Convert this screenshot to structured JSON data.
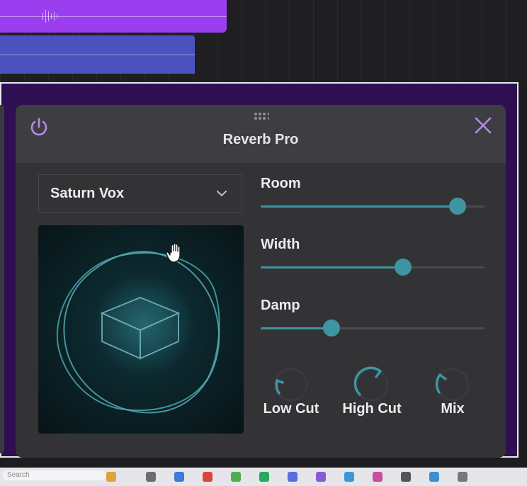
{
  "plugin": {
    "title": "Reverb Pro",
    "preset": "Saturn Vox"
  },
  "sliders": [
    {
      "label": "Room",
      "value": 0.88
    },
    {
      "label": "Width",
      "value": 0.635
    },
    {
      "label": "Damp",
      "value": 0.315
    }
  ],
  "knobs": [
    {
      "label": "Low Cut"
    },
    {
      "label": "High Cut"
    },
    {
      "label": "Mix"
    }
  ],
  "taskbar": {
    "search": "Search"
  },
  "colors": {
    "accent": "#3e95a2",
    "power_icon": "#b28ce8",
    "close_icon": "#b28ce8",
    "host_frame": "#2e0f52",
    "clip_purple": "#9b3ef0",
    "clip_blue": "#4b52bd"
  },
  "icons": {
    "power": "power-icon",
    "close": "close-icon",
    "drag": "drag-handle-icon",
    "dropdown": "chevron-down-icon",
    "cursor": "hand-cursor-icon"
  }
}
